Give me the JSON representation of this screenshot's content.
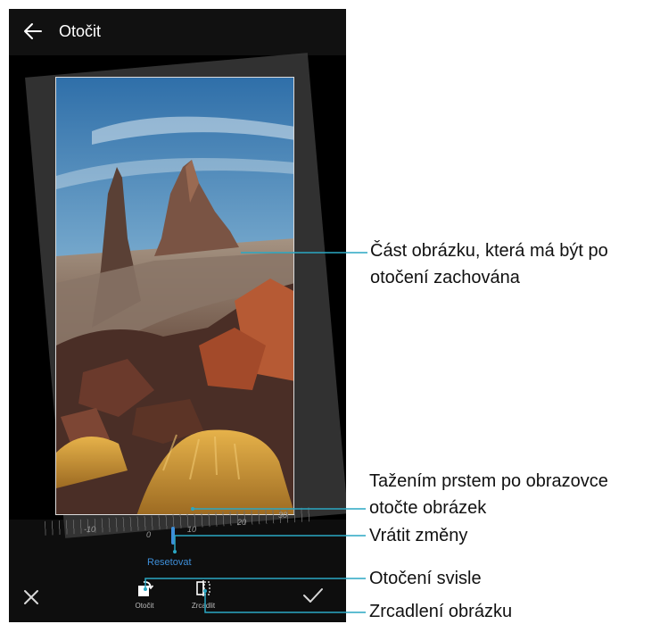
{
  "header": {
    "back_icon": "arrow-left-icon",
    "title": "Otočit"
  },
  "dial": {
    "labels": [
      "-10",
      "0",
      "10",
      "20",
      "30"
    ]
  },
  "toolbar": {
    "reset_label": "Resetovat",
    "rotate_label": "Otočit",
    "mirror_label": "Zrcadlit",
    "close_icon": "close-icon",
    "confirm_icon": "check-icon"
  },
  "annotations": {
    "keep_line1": "Část obrázku, která má být po",
    "keep_line2": "otočení zachována",
    "drag_line1": "Tažením prstem po obrazovce",
    "drag_line2": "otočte obrázek",
    "reset": "Vrátit změny",
    "rotate": "Otočení svisle",
    "mirror": "Zrcadlení obrázku"
  },
  "colors": {
    "accent": "#3e8fd9",
    "callout_line": "#2aa7c3"
  }
}
